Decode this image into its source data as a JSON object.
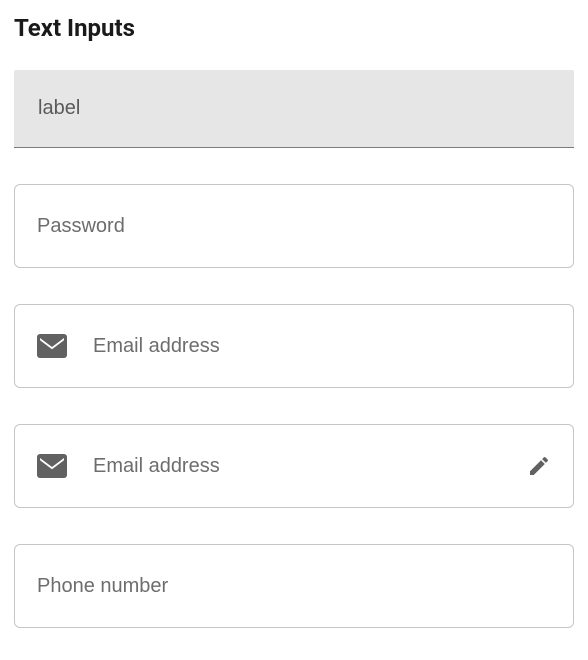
{
  "section": {
    "title": "Text Inputs"
  },
  "fields": {
    "label": {
      "placeholder": "label",
      "value": ""
    },
    "password": {
      "placeholder": "Password",
      "value": ""
    },
    "email1": {
      "placeholder": "Email address",
      "value": ""
    },
    "email2": {
      "placeholder": "Email address",
      "value": ""
    },
    "phone": {
      "placeholder": "Phone number",
      "value": ""
    }
  }
}
